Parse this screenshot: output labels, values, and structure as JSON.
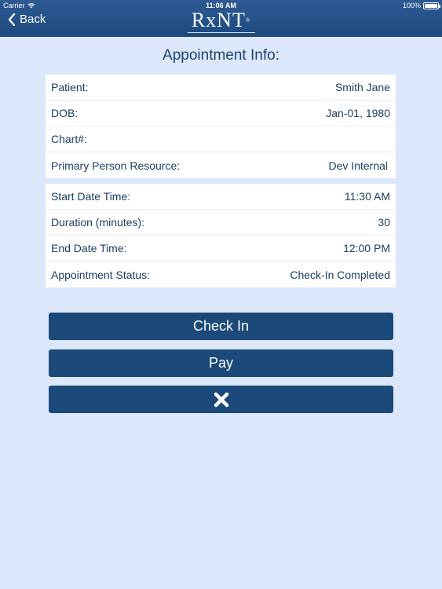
{
  "status_bar": {
    "carrier": "Carrier",
    "time": "11:06 AM",
    "battery": "100%"
  },
  "nav": {
    "back_label": "Back",
    "logo_text": "RxNT",
    "logo_tm": "®"
  },
  "page": {
    "title": "Appointment Info:"
  },
  "patient_info": [
    {
      "label": "Patient:",
      "value": "Smith Jane"
    },
    {
      "label": "DOB:",
      "value": "Jan-01, 1980"
    },
    {
      "label": "Chart#:",
      "value": ""
    },
    {
      "label": "Primary Person Resource:",
      "value": "Dev Internal"
    }
  ],
  "appointment_info": [
    {
      "label": "Start Date Time:",
      "value": "11:30 AM"
    },
    {
      "label": "Duration (minutes):",
      "value": "30"
    },
    {
      "label": "End Date Time:",
      "value": "12:00 PM"
    },
    {
      "label": "Appointment Status:",
      "value": "Check-In Completed"
    }
  ],
  "actions": {
    "check_in_label": "Check In",
    "pay_label": "Pay",
    "close_icon": "close-x-icon"
  },
  "colors": {
    "header": "#1d4a80",
    "background": "#dde7fb",
    "button": "#1b4979",
    "text": "#1c3f63"
  }
}
